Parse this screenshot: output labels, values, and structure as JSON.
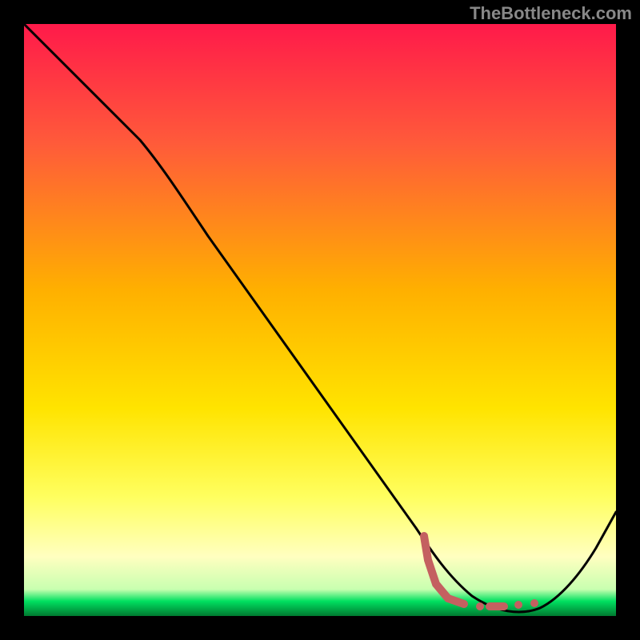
{
  "watermark": "TheBottleneck.com",
  "colors": {
    "bg": "#000000",
    "grad_top": "#ff1a4a",
    "grad_mid1": "#ff6a2a",
    "grad_mid2": "#ffd400",
    "grad_yellow": "#ffff4a",
    "grad_pale": "#ffffa0",
    "grad_green": "#00e060",
    "curve": "#000000",
    "dash": "#c46060"
  },
  "chart_data": {
    "type": "line",
    "title": "",
    "xlabel": "",
    "ylabel": "",
    "xlim": [
      0,
      100
    ],
    "ylim": [
      0,
      100
    ],
    "grid": false,
    "legend": false,
    "series": [
      {
        "name": "curve",
        "x": [
          0,
          8,
          14,
          20,
          24,
          30,
          40,
          50,
          60,
          65,
          70,
          74,
          78,
          82,
          86,
          90,
          94,
          100
        ],
        "y": [
          100,
          92,
          86,
          80,
          75,
          67,
          54,
          41,
          28,
          21,
          14,
          9,
          5,
          3,
          3,
          6,
          12,
          24
        ]
      },
      {
        "name": "highlight-dashes",
        "x": [
          65,
          66,
          66,
          67,
          68,
          69,
          72,
          75,
          78,
          80,
          82
        ],
        "y": [
          21,
          18,
          15,
          12,
          10,
          8,
          6,
          5,
          4,
          4,
          4
        ]
      }
    ],
    "annotations": []
  }
}
